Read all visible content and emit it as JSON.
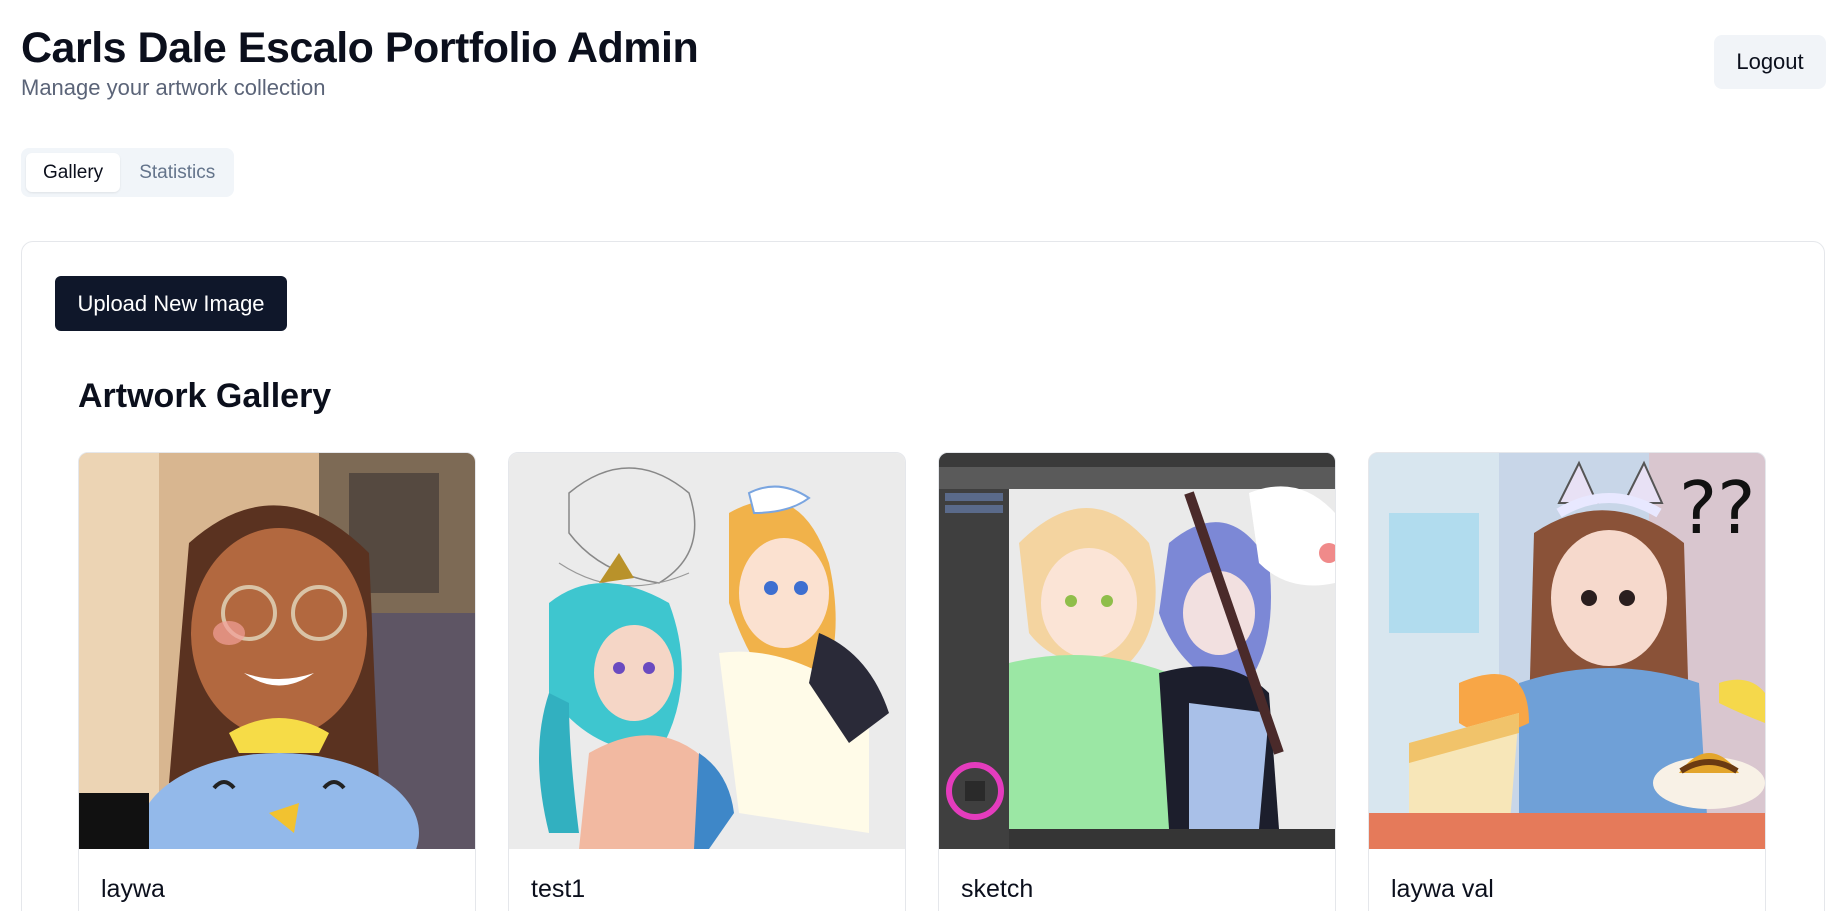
{
  "header": {
    "title": "Carls Dale Escalo Portfolio Admin",
    "subtitle": "Manage your artwork collection",
    "logout_label": "Logout"
  },
  "tabs": [
    {
      "label": "Gallery",
      "active": true
    },
    {
      "label": "Statistics",
      "active": false
    }
  ],
  "panel": {
    "upload_label": "Upload New Image",
    "section_title": "Artwork Gallery"
  },
  "artworks": [
    {
      "title": "laywa"
    },
    {
      "title": "test1"
    },
    {
      "title": "sketch"
    },
    {
      "title": "laywa val"
    }
  ],
  "colors": {
    "primary": "#0f172a",
    "muted_text": "#64748b",
    "tab_bg": "#f1f5f9",
    "border": "#e5e7eb"
  }
}
